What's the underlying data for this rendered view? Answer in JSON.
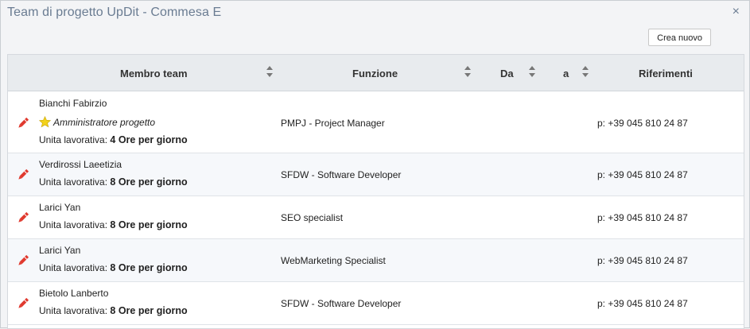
{
  "dialog": {
    "title": "Team di progetto UpDit - Commesa E",
    "close_glyph": "×"
  },
  "toolbar": {
    "new_label": "Crea nuovo"
  },
  "table": {
    "headers": {
      "member": "Membro team",
      "function": "Funzione",
      "from": "Da",
      "to": "a",
      "references": "Riferimenti"
    },
    "unit_prefix": "Unita lavorativa:",
    "rows": [
      {
        "name": "Bianchi Fabirzio",
        "role": "Amministratore progetto",
        "unit": "4 Ore per giorno",
        "function": "PMPJ - Project Manager",
        "reference": "p: +39 045 810 24 87"
      },
      {
        "name": "Verdirossi Laeetizia",
        "unit": "8 Ore per giorno",
        "function": "SFDW - Software Developer",
        "reference": "p: +39 045 810 24 87"
      },
      {
        "name": "Larici Yan",
        "unit": "8 Ore per giorno",
        "function": "SEO specialist",
        "reference": "p: +39 045 810 24 87"
      },
      {
        "name": "Larici Yan",
        "unit": "8 Ore per giorno",
        "function": "WebMarketing Specialist",
        "reference": "p: +39 045 810 24 87"
      },
      {
        "name": "Bietolo Lanberto",
        "unit": "8 Ore per giorno",
        "function": "SFDW - Software Developer",
        "reference": "p: +39 045 810 24 87"
      }
    ]
  },
  "colors": {
    "title": "#6a7c92",
    "edit_icon": "#e03a2f",
    "star": "#f3d21a"
  }
}
